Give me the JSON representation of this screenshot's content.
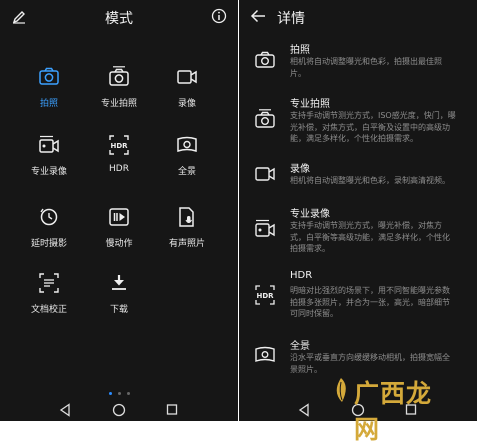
{
  "left_screen": {
    "title": "模式",
    "modes": [
      {
        "label": "拍照",
        "icon": "camera-icon",
        "active": true
      },
      {
        "label": "专业拍照",
        "icon": "pro-camera-icon",
        "active": false
      },
      {
        "label": "录像",
        "icon": "video-icon",
        "active": false
      },
      {
        "label": "专业录像",
        "icon": "pro-video-icon",
        "active": false
      },
      {
        "label": "HDR",
        "icon": "hdr-icon",
        "active": false
      },
      {
        "label": "全景",
        "icon": "panorama-icon",
        "active": false
      },
      {
        "label": "延时摄影",
        "icon": "timelapse-icon",
        "active": false
      },
      {
        "label": "慢动作",
        "icon": "slow-motion-icon",
        "active": false
      },
      {
        "label": "有声照片",
        "icon": "audio-photo-icon",
        "active": false
      },
      {
        "label": "文档校正",
        "icon": "document-correction-icon",
        "active": false
      },
      {
        "label": "下载",
        "icon": "download-icon",
        "active": false
      }
    ],
    "page_indicator": {
      "pages": 3,
      "current": 1
    },
    "hdr_icon_text": "HDR"
  },
  "right_screen": {
    "title": "详情",
    "details": [
      {
        "title": "拍照",
        "desc": [
          "相机将自动调整曝光和色彩，拍摄出最佳照",
          "片。"
        ]
      },
      {
        "title": "专业拍照",
        "desc": [
          "支持手动调节测光方式，ISO感光度，快门，曝",
          "光补偿，对焦方式，白平衡及设置中的高级功",
          "能，满足多样化，个性化拍摄需求。"
        ]
      },
      {
        "title": "录像",
        "desc": [
          "相机将自动调整曝光和色彩，录制高清视频。"
        ]
      },
      {
        "title": "专业录像",
        "desc": [
          "支持手动调节测光方式，曝光补偿，对焦方",
          "式，白平衡等高级功能，满足多样化，个性化",
          "拍摄需求。"
        ]
      },
      {
        "title": "HDR",
        "desc": [
          "明暗对比强烈的场景下，用不同智能曝光参数",
          "拍摄多张照片，并合为一张，高光，暗部细节",
          "可同时保留。"
        ]
      },
      {
        "title": "全景",
        "desc": [
          "沿水平或垂直方向缓缓移动相机，拍摄宽幅全",
          "景照片。"
        ]
      }
    ]
  },
  "watermark": {
    "text": "广西龙网"
  },
  "colors": {
    "background": "#161616",
    "accent": "#3ba0ff",
    "text": "#e8e8e8",
    "muted": "#8e8e8e",
    "watermark": "#d4a93a"
  }
}
